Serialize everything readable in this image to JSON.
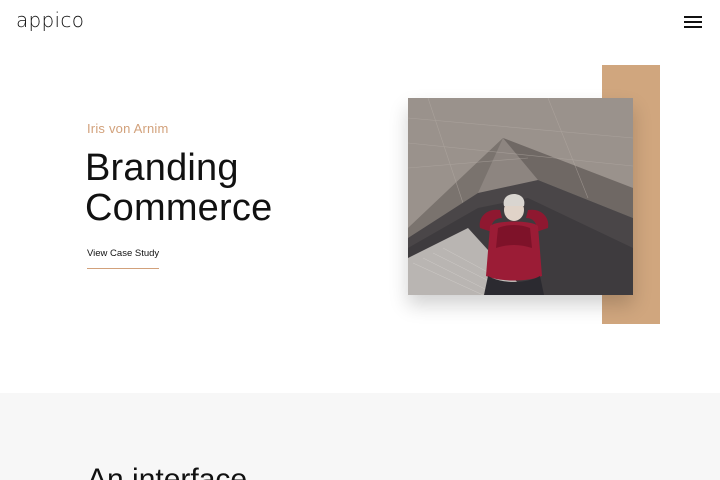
{
  "header": {
    "logo": "appico",
    "menu_icon": "hamburger-menu-icon"
  },
  "hero": {
    "client": "Iris von Arnim",
    "title_line1": "Branding",
    "title_line2": "Commerce",
    "cta_label": "View Case Study",
    "accent_color": "#d0a67e",
    "image_alt": "photo-person-lying-on-rug"
  },
  "section2": {
    "title_partial": "An interface"
  }
}
